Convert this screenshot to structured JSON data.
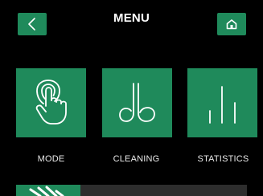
{
  "header": {
    "title": "MENU",
    "back_icon": "chevron-left-icon",
    "home_icon": "home-icon"
  },
  "colors": {
    "accent": "#1f8a5b",
    "background": "#000000",
    "icon_stroke": "#ffffff",
    "progress_track": "#2d2d2d"
  },
  "menu": {
    "tiles": [
      {
        "label": "MODE",
        "icon": "touch-hand-icon"
      },
      {
        "label": "CLEANING",
        "icon": "cleaning-icon"
      },
      {
        "label": "STATISTICS",
        "icon": "bar-chart-icon"
      }
    ]
  },
  "progress": {
    "fraction": 0.28,
    "icon": "brush-icon"
  }
}
